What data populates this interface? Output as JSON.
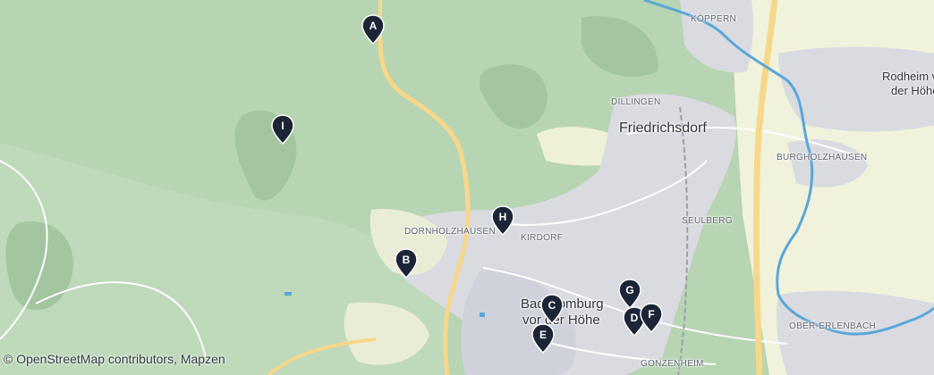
{
  "map": {
    "colors": {
      "forest": "#b7d4b3",
      "forest_dark": "#a3c59f",
      "urban": "#d9dbe1",
      "field": "#f0f2dc",
      "motorway": "#f7d78a",
      "water": "#5aa6d8"
    },
    "places": [
      {
        "id": "koppern",
        "name": "KÖPPERN",
        "kind": "suburb"
      },
      {
        "id": "dillingen",
        "name": "DILLINGEN",
        "kind": "suburb"
      },
      {
        "id": "friedrichsdorf",
        "name": "Friedrichsdorf",
        "kind": "town"
      },
      {
        "id": "rodheim",
        "name": "Rodheim v",
        "kind": "town-part"
      },
      {
        "id": "rodheim2",
        "name": "der Höhe",
        "kind": "town-part"
      },
      {
        "id": "burgholzhausen",
        "name": "BURGHOLZHAUSEN",
        "kind": "suburb"
      },
      {
        "id": "seulberg",
        "name": "SEULBERG",
        "kind": "suburb"
      },
      {
        "id": "dornholzhausen",
        "name": "DORNHOLZHAUSEN",
        "kind": "suburb"
      },
      {
        "id": "kirdorf",
        "name": "KIRDORF",
        "kind": "suburb"
      },
      {
        "id": "badhomburg1",
        "name": "Bad Homburg",
        "kind": "city"
      },
      {
        "id": "badhomburg2",
        "name": "vor der Höhe",
        "kind": "city"
      },
      {
        "id": "obererlenbach",
        "name": "OBER-ERLENBACH",
        "kind": "suburb"
      },
      {
        "id": "gonzenheim",
        "name": "GONZENHEIM",
        "kind": "suburb"
      }
    ],
    "markers": [
      {
        "label": "A"
      },
      {
        "label": "B"
      },
      {
        "label": "C"
      },
      {
        "label": "D"
      },
      {
        "label": "E"
      },
      {
        "label": "F"
      },
      {
        "label": "G"
      },
      {
        "label": "H"
      },
      {
        "label": "I"
      }
    ],
    "marker_color": "#1c2536",
    "attribution": "© OpenStreetMap contributors, Mapzen"
  }
}
